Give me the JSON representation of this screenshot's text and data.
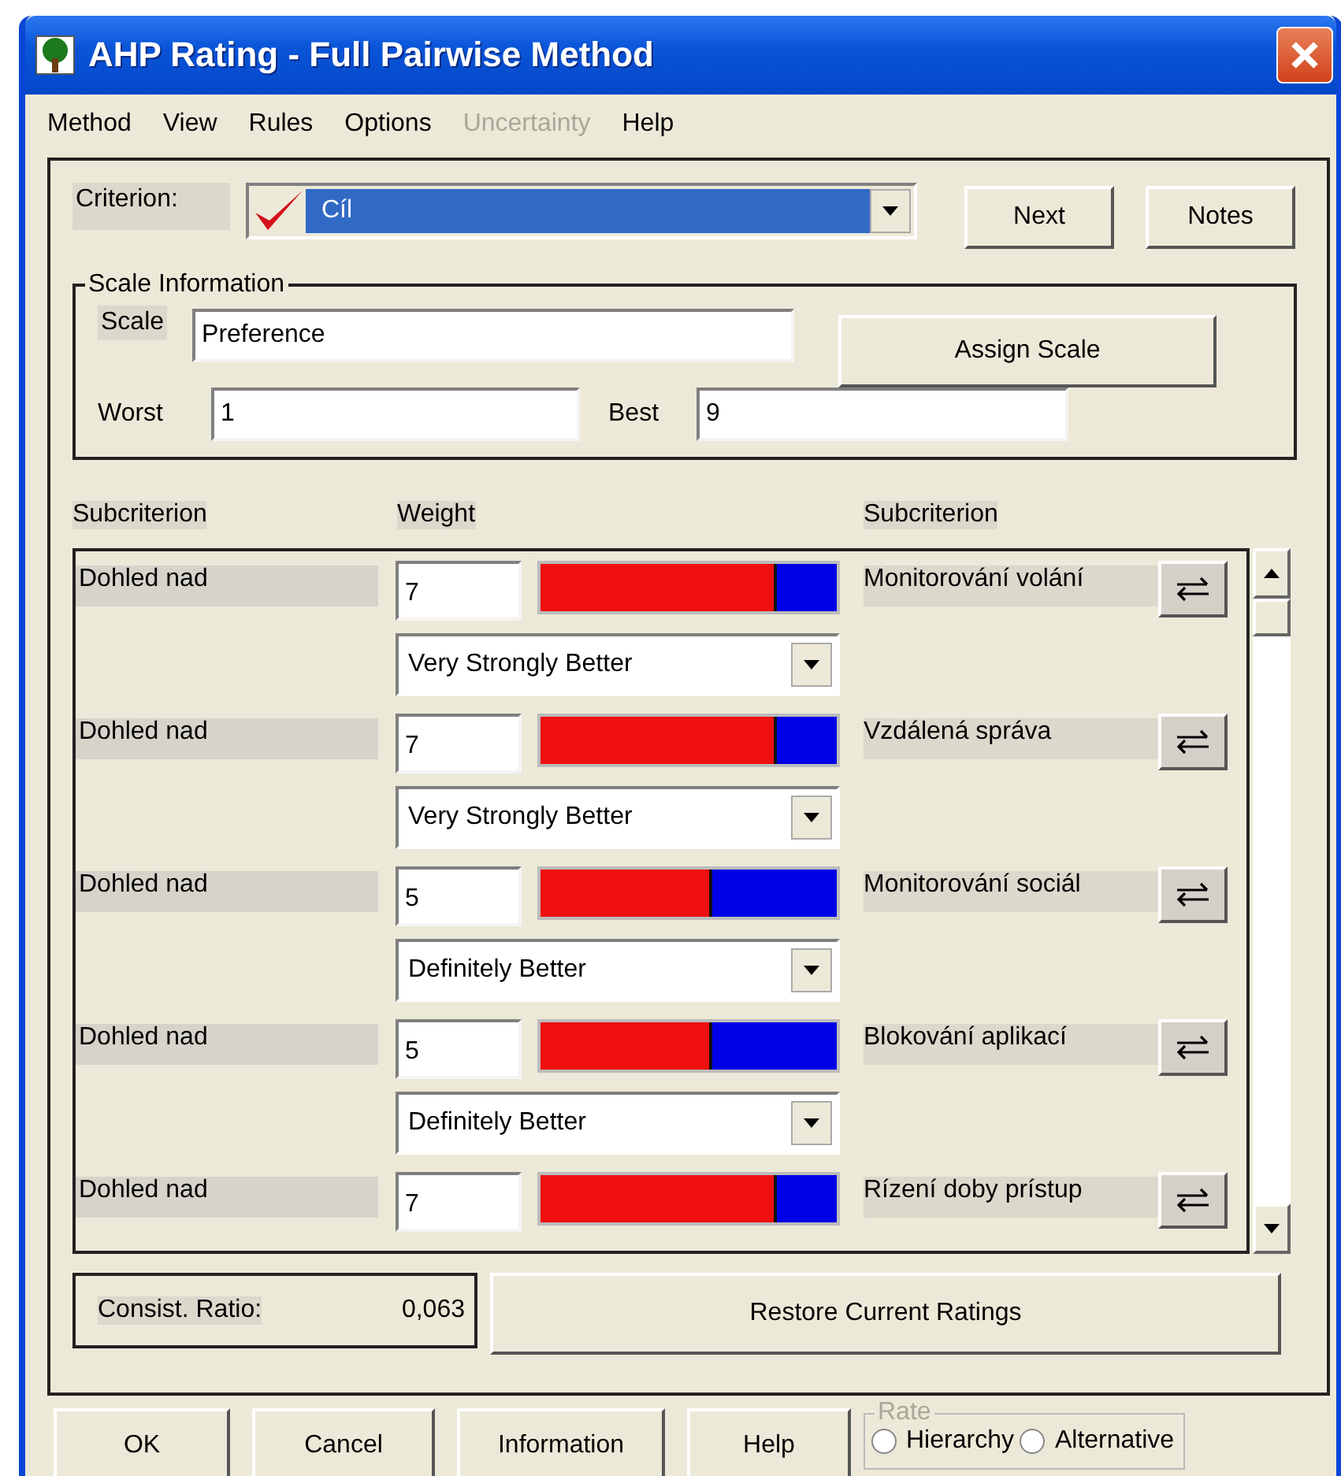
{
  "window": {
    "title": "AHP Rating - Full Pairwise Method"
  },
  "menu": [
    {
      "label": "Method",
      "disabled": false
    },
    {
      "label": "View",
      "disabled": false
    },
    {
      "label": "Rules",
      "disabled": false
    },
    {
      "label": "Options",
      "disabled": false
    },
    {
      "label": "Uncertainty",
      "disabled": true
    },
    {
      "label": "Help",
      "disabled": false
    }
  ],
  "criterion": {
    "label": "Criterion:",
    "value": "Cíl"
  },
  "top_buttons": [
    {
      "label": "Next"
    },
    {
      "label": "Notes"
    }
  ],
  "scale_info": {
    "title": "Scale Information",
    "scale_label": "Scale",
    "scale_value": "Preference",
    "assign": {
      "label": "Assign Scale"
    },
    "worst_label": "Worst",
    "worst_value": "1",
    "best_label": "Best",
    "best_value": "9"
  },
  "headers": [
    "Subcriterion",
    "Weight",
    "Subcriterion"
  ],
  "comparisons": [
    {
      "left": "Dohled nad",
      "weight": "7",
      "level": 0.8,
      "verbal": "Very Strongly Better",
      "right": "Monitorování volání"
    },
    {
      "left": "Dohled nad",
      "weight": "7",
      "level": 0.8,
      "verbal": "Very Strongly Better",
      "right": "Vzdálená správa"
    },
    {
      "left": "Dohled nad",
      "weight": "5",
      "level": 0.58,
      "verbal": "Definitely Better",
      "right": "Monitorování sociál"
    },
    {
      "left": "Dohled nad",
      "weight": "5",
      "level": 0.58,
      "verbal": "Definitely Better",
      "right": "Blokování aplikací"
    },
    {
      "left": "Dohled nad",
      "weight": "7",
      "level": 0.8,
      "right": "Rízení doby prístup"
    }
  ],
  "consistency": {
    "label": "Consist. Ratio:",
    "value": "0,063"
  },
  "restore": {
    "label": "Restore Current Ratings"
  },
  "bottom_buttons": [
    {
      "label": "OK"
    },
    {
      "label": "Cancel"
    },
    {
      "label": "Information"
    },
    {
      "label": "Help"
    }
  ],
  "rate": {
    "title": "Rate",
    "disabled": true,
    "options": [
      {
        "label": "Hierarchy",
        "selected": false
      },
      {
        "label": "Alternative",
        "selected": false
      }
    ]
  }
}
